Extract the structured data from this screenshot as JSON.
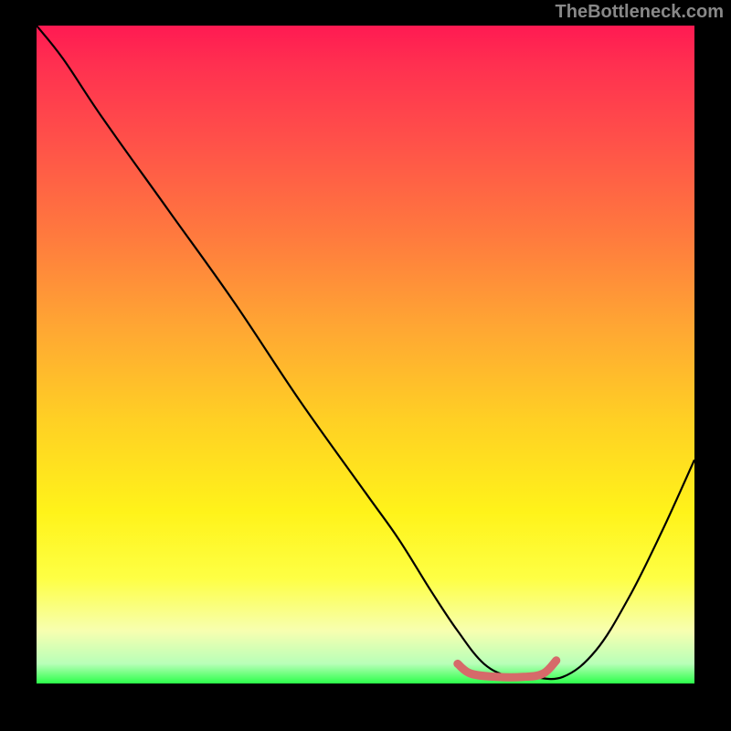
{
  "watermark": "TheBottleneck.com",
  "chart_data": {
    "type": "line",
    "title": "",
    "xlabel": "",
    "ylabel": "",
    "xlim": [
      0,
      100
    ],
    "ylim": [
      0,
      100
    ],
    "series": [
      {
        "name": "bottleneck-curve",
        "x": [
          0,
          4,
          10,
          20,
          30,
          40,
          50,
          55,
          60,
          64,
          68,
          72,
          75,
          80,
          85,
          90,
          95,
          100
        ],
        "y": [
          100,
          95,
          86,
          72,
          58,
          43,
          29,
          22,
          14,
          8,
          3,
          1,
          1,
          1,
          5,
          13,
          23,
          34
        ]
      },
      {
        "name": "optimal-range-marker",
        "x": [
          64,
          66,
          70,
          74,
          77,
          79
        ],
        "y": [
          3,
          1.5,
          1,
          1,
          1.5,
          3.5
        ]
      }
    ],
    "gradient_stops": [
      {
        "pos": 0,
        "color": "#ff1a52"
      },
      {
        "pos": 6,
        "color": "#ff3050"
      },
      {
        "pos": 18,
        "color": "#ff5249"
      },
      {
        "pos": 32,
        "color": "#ff7a3e"
      },
      {
        "pos": 46,
        "color": "#ffa733"
      },
      {
        "pos": 60,
        "color": "#ffd024"
      },
      {
        "pos": 74,
        "color": "#fff31a"
      },
      {
        "pos": 84,
        "color": "#feff44"
      },
      {
        "pos": 92,
        "color": "#f7ffb0"
      },
      {
        "pos": 97,
        "color": "#b8ffb8"
      },
      {
        "pos": 100,
        "color": "#2bff4a"
      }
    ]
  }
}
